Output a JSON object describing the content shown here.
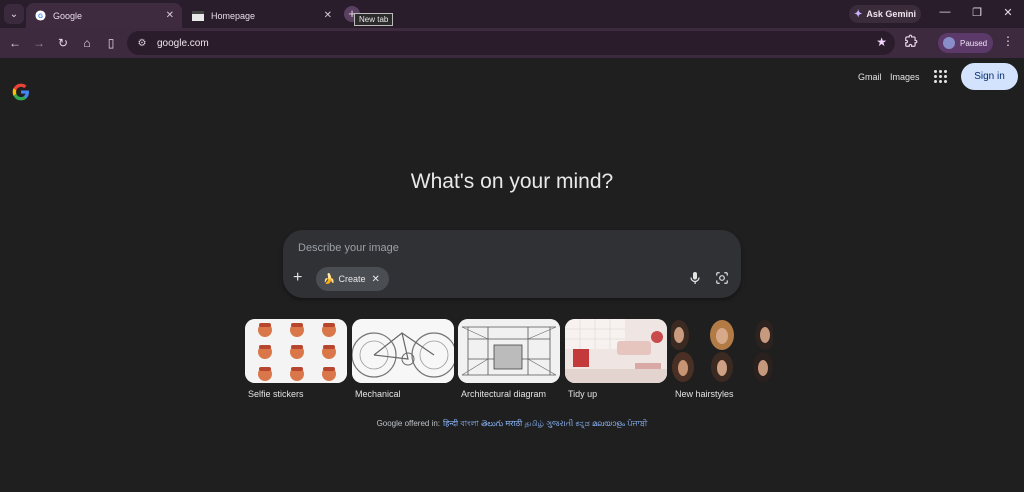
{
  "browser": {
    "tabs": [
      {
        "title": "Google",
        "active": true
      },
      {
        "title": "Homepage",
        "active": false
      }
    ],
    "new_tab_tooltip": "New tab",
    "ask_gemini_label": "Ask Gemini",
    "address": "google.com",
    "profile_status": "Paused"
  },
  "header": {
    "gmail_label": "Gmail",
    "images_label": "Images",
    "sign_in_label": "Sign in"
  },
  "main": {
    "headline": "What's on your mind?",
    "search_placeholder": "Describe your image",
    "create_chip_label": "Create",
    "suggestions": [
      {
        "label": "Selfie stickers"
      },
      {
        "label": "Mechanical"
      },
      {
        "label": "Architectural diagram"
      },
      {
        "label": "Tidy up"
      },
      {
        "label": "New hairstyles"
      }
    ],
    "offered_in_prefix": "Google offered in:",
    "languages": "हिन्दी বাংলা తెలుగు मराठी தமிழ் ગુજરાતી ಕನ್ನಡ മലയാളം ਪੰਜਾਬੀ"
  },
  "colors": {
    "page_bg": "#1f1f1f",
    "tabbar_bg": "#2a1d2b",
    "toolbar_bg": "#3e2a3f",
    "search_bg": "#303134",
    "sign_in_bg": "#d3e3fd",
    "link_blue": "#8ab4f8"
  }
}
